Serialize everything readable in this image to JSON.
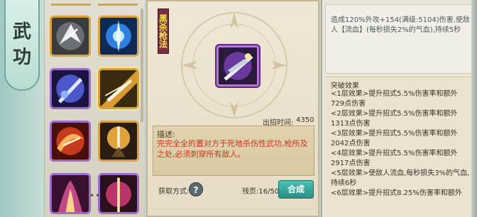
{
  "side_tab": {
    "char1": "武",
    "char2": "功"
  },
  "skill_grid": {
    "slots": [
      {
        "icon": "silver-wolf-skill-icon"
      },
      {
        "icon": "blue-spear-burst-skill-icon"
      },
      {
        "icon": "blue-swirl-spear-skill-icon"
      },
      {
        "icon": "golden-spear-thrust-skill-icon"
      },
      {
        "icon": "fire-slash-skill-icon"
      },
      {
        "icon": "golden-halo-spear-skill-icon"
      },
      {
        "icon": "purple-flame-skill-icon"
      },
      {
        "icon": "crimson-spear-skill-icon"
      }
    ],
    "more": "••"
  },
  "detail": {
    "banner": "黑杀枪法",
    "time_label": "出招时间:",
    "time_value": "4350",
    "desc_title": "描述:",
    "desc_text": "完完全全的置对方于死地杀伤性武功,枪所及之处,必须刺穿所有敌人。",
    "get_label": "获取方式:",
    "help": "?",
    "fragments": "残页:16/50",
    "craft_button": "合成"
  },
  "info": {
    "damage_text": "造成120%外攻+154(满级:5104)伤害,使敌人【流血】(每秒损失2%的气血),持续5秒",
    "break_title": "突破效果",
    "break_effects": [
      "<1层效果>提升招式5.5%伤害率和额外729点伤害",
      "<2层效果>提升招式5.5%伤害率和额外1313点伤害",
      "<3层效果>提升招式5.5%伤害率和额外2042点伤害",
      "<4层效果>提升招式5.5%伤害率和额外2917点伤害",
      "<5层效果>使敌人流血,每秒损失3%的气血,持续6秒",
      "<6层效果>提升招式8.25%伤害率和额外"
    ]
  },
  "colors": {
    "accent_teal": "#2a8e85",
    "banner_red": "#7a2f3f",
    "desc_red": "#c2371f",
    "frame_purple": "#9c6bc8",
    "frame_gold": "#d7a33a"
  }
}
